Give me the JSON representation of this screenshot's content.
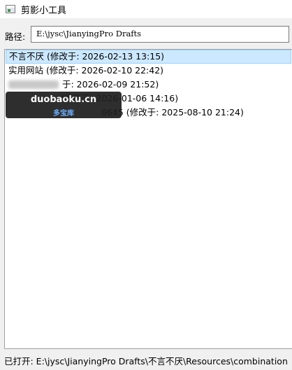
{
  "window": {
    "title": "剪影小工具",
    "icon": "app-window-icon"
  },
  "path": {
    "label": "路径:",
    "value": "E:\\jysc\\JianyingPro Drafts"
  },
  "drafts": {
    "items": [
      {
        "text": "不言不厌 (修改于: 2026-02-13 13:15)",
        "selected": true
      },
      {
        "text": "实用网站 (修改于: 2026-02-10 22:42)",
        "selected": false
      },
      {
        "text": "于: 2026-02-09 21:52)",
        "selected": false,
        "obscured": true
      },
      {
        "text": "(修改于: 2026-01-06 14:16)",
        "selected": false,
        "obscured": true
      },
      {
        "text": "0645 (修改于: 2025-08-10 21:24)",
        "selected": false,
        "obscured": true
      }
    ]
  },
  "overlay": {
    "main": "duobaoku.cn",
    "sub": "多宝库"
  },
  "status": {
    "text": "已打开: E:\\jysc\\JianyingPro Drafts\\不言不厌\\Resources\\combination"
  }
}
